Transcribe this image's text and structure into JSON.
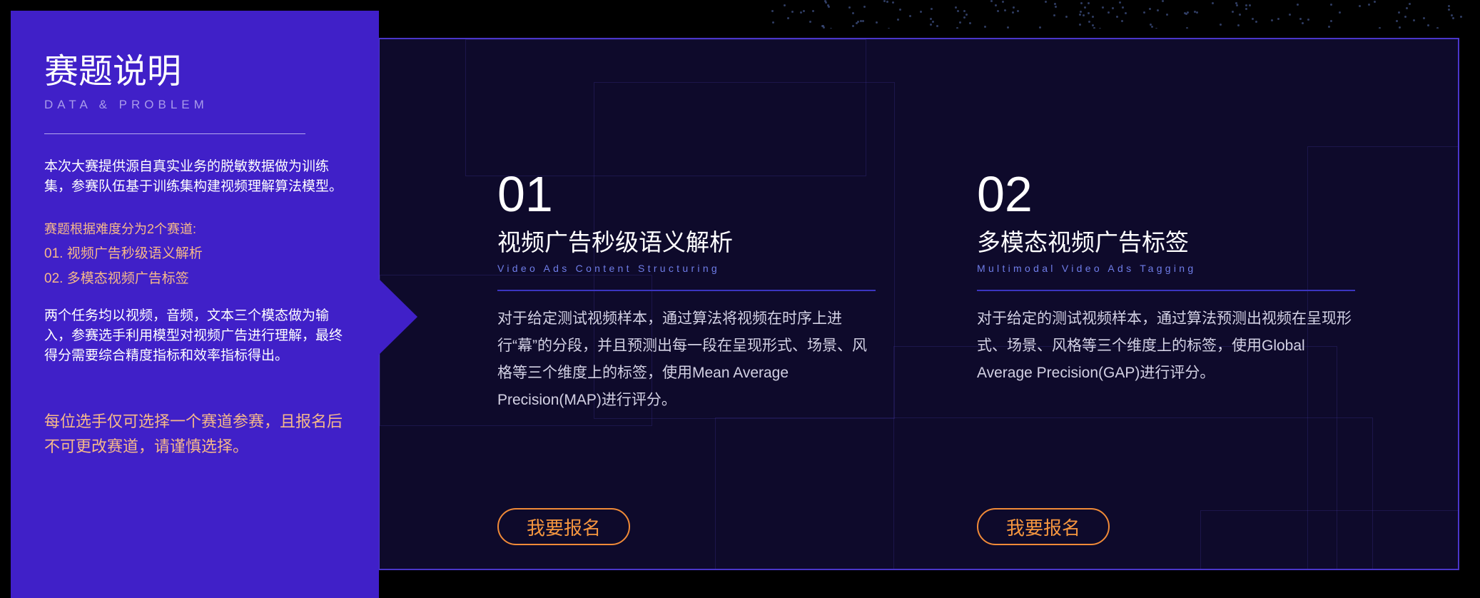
{
  "left": {
    "title": "赛题说明",
    "subtitle": "DATA & PROBLEM",
    "intro": "本次大赛提供源自真实业务的脱敏数据做为训练集，参赛队伍基于训练集构建视频理解算法模型。",
    "tracks_head": "赛题根据难度分为2个赛道:",
    "tracks": [
      "01. 视频广告秒级语义解析",
      "02. 多模态视频广告标签"
    ],
    "desc": "两个任务均以视频，音频，文本三个模态做为输入，参赛选手利用模型对视频广告进行理解，最终得分需要综合精度指标和效率指标得出。",
    "notice": "每位选手仅可选择一个赛道参赛，且报名后不可更改赛道，请谨慎选择。"
  },
  "cards": [
    {
      "num": "01",
      "title": "视频广告秒级语义解析",
      "subtitle": "Video Ads Content Structuring",
      "text": "对于给定测试视频样本，通过算法将视频在时序上进行“幕”的分段，并且预测出每一段在呈现形式、场景、风格等三个维度上的标签，使用Mean Average Precision(MAP)进行评分。",
      "button": "我要报名"
    },
    {
      "num": "02",
      "title": "多模态视频广告标签",
      "subtitle": "Multimodal Video Ads Tagging",
      "text": "对于给定的测试视频样本，通过算法预测出视频在呈现形式、场景、风格等三个维度上的标签，使用Global Average Precision(GAP)进行评分。",
      "button": "我要报名"
    }
  ],
  "colors": {
    "accent_purple": "#4020c8",
    "panel_bg": "#0e0a2b",
    "highlight_orange": "#f6b98a",
    "button_orange": "#f08a38"
  }
}
